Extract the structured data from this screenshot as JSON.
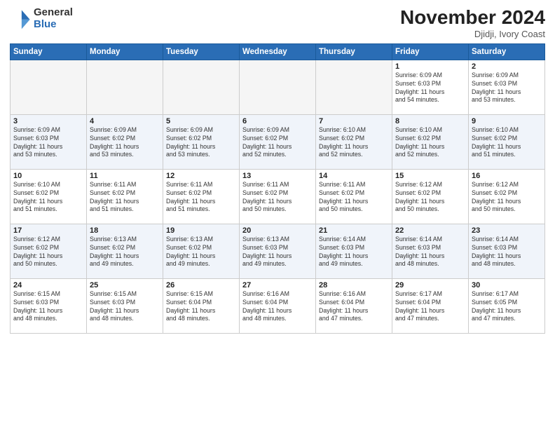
{
  "logo": {
    "general": "General",
    "blue": "Blue"
  },
  "header": {
    "month": "November 2024",
    "location": "Djidji, Ivory Coast"
  },
  "weekdays": [
    "Sunday",
    "Monday",
    "Tuesday",
    "Wednesday",
    "Thursday",
    "Friday",
    "Saturday"
  ],
  "weeks": [
    [
      {
        "day": "",
        "info": ""
      },
      {
        "day": "",
        "info": ""
      },
      {
        "day": "",
        "info": ""
      },
      {
        "day": "",
        "info": ""
      },
      {
        "day": "",
        "info": ""
      },
      {
        "day": "1",
        "info": "Sunrise: 6:09 AM\nSunset: 6:03 PM\nDaylight: 11 hours\nand 54 minutes."
      },
      {
        "day": "2",
        "info": "Sunrise: 6:09 AM\nSunset: 6:03 PM\nDaylight: 11 hours\nand 53 minutes."
      }
    ],
    [
      {
        "day": "3",
        "info": "Sunrise: 6:09 AM\nSunset: 6:03 PM\nDaylight: 11 hours\nand 53 minutes."
      },
      {
        "day": "4",
        "info": "Sunrise: 6:09 AM\nSunset: 6:02 PM\nDaylight: 11 hours\nand 53 minutes."
      },
      {
        "day": "5",
        "info": "Sunrise: 6:09 AM\nSunset: 6:02 PM\nDaylight: 11 hours\nand 53 minutes."
      },
      {
        "day": "6",
        "info": "Sunrise: 6:09 AM\nSunset: 6:02 PM\nDaylight: 11 hours\nand 52 minutes."
      },
      {
        "day": "7",
        "info": "Sunrise: 6:10 AM\nSunset: 6:02 PM\nDaylight: 11 hours\nand 52 minutes."
      },
      {
        "day": "8",
        "info": "Sunrise: 6:10 AM\nSunset: 6:02 PM\nDaylight: 11 hours\nand 52 minutes."
      },
      {
        "day": "9",
        "info": "Sunrise: 6:10 AM\nSunset: 6:02 PM\nDaylight: 11 hours\nand 51 minutes."
      }
    ],
    [
      {
        "day": "10",
        "info": "Sunrise: 6:10 AM\nSunset: 6:02 PM\nDaylight: 11 hours\nand 51 minutes."
      },
      {
        "day": "11",
        "info": "Sunrise: 6:11 AM\nSunset: 6:02 PM\nDaylight: 11 hours\nand 51 minutes."
      },
      {
        "day": "12",
        "info": "Sunrise: 6:11 AM\nSunset: 6:02 PM\nDaylight: 11 hours\nand 51 minutes."
      },
      {
        "day": "13",
        "info": "Sunrise: 6:11 AM\nSunset: 6:02 PM\nDaylight: 11 hours\nand 50 minutes."
      },
      {
        "day": "14",
        "info": "Sunrise: 6:11 AM\nSunset: 6:02 PM\nDaylight: 11 hours\nand 50 minutes."
      },
      {
        "day": "15",
        "info": "Sunrise: 6:12 AM\nSunset: 6:02 PM\nDaylight: 11 hours\nand 50 minutes."
      },
      {
        "day": "16",
        "info": "Sunrise: 6:12 AM\nSunset: 6:02 PM\nDaylight: 11 hours\nand 50 minutes."
      }
    ],
    [
      {
        "day": "17",
        "info": "Sunrise: 6:12 AM\nSunset: 6:02 PM\nDaylight: 11 hours\nand 50 minutes."
      },
      {
        "day": "18",
        "info": "Sunrise: 6:13 AM\nSunset: 6:02 PM\nDaylight: 11 hours\nand 49 minutes."
      },
      {
        "day": "19",
        "info": "Sunrise: 6:13 AM\nSunset: 6:02 PM\nDaylight: 11 hours\nand 49 minutes."
      },
      {
        "day": "20",
        "info": "Sunrise: 6:13 AM\nSunset: 6:03 PM\nDaylight: 11 hours\nand 49 minutes."
      },
      {
        "day": "21",
        "info": "Sunrise: 6:14 AM\nSunset: 6:03 PM\nDaylight: 11 hours\nand 49 minutes."
      },
      {
        "day": "22",
        "info": "Sunrise: 6:14 AM\nSunset: 6:03 PM\nDaylight: 11 hours\nand 48 minutes."
      },
      {
        "day": "23",
        "info": "Sunrise: 6:14 AM\nSunset: 6:03 PM\nDaylight: 11 hours\nand 48 minutes."
      }
    ],
    [
      {
        "day": "24",
        "info": "Sunrise: 6:15 AM\nSunset: 6:03 PM\nDaylight: 11 hours\nand 48 minutes."
      },
      {
        "day": "25",
        "info": "Sunrise: 6:15 AM\nSunset: 6:03 PM\nDaylight: 11 hours\nand 48 minutes."
      },
      {
        "day": "26",
        "info": "Sunrise: 6:15 AM\nSunset: 6:04 PM\nDaylight: 11 hours\nand 48 minutes."
      },
      {
        "day": "27",
        "info": "Sunrise: 6:16 AM\nSunset: 6:04 PM\nDaylight: 11 hours\nand 48 minutes."
      },
      {
        "day": "28",
        "info": "Sunrise: 6:16 AM\nSunset: 6:04 PM\nDaylight: 11 hours\nand 47 minutes."
      },
      {
        "day": "29",
        "info": "Sunrise: 6:17 AM\nSunset: 6:04 PM\nDaylight: 11 hours\nand 47 minutes."
      },
      {
        "day": "30",
        "info": "Sunrise: 6:17 AM\nSunset: 6:05 PM\nDaylight: 11 hours\nand 47 minutes."
      }
    ]
  ]
}
